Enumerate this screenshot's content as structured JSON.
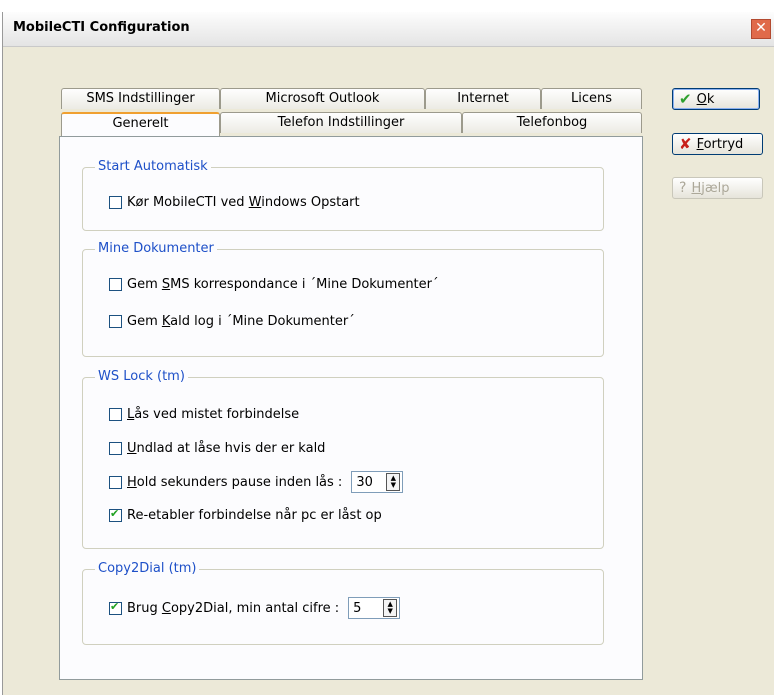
{
  "window": {
    "title": "MobileCTI Configuration",
    "close_glyph": "✕"
  },
  "tabs_row1": [
    "SMS Indstillinger",
    "Microsoft Outlook",
    "Internet",
    "Licens"
  ],
  "tabs_row2": [
    "Generelt",
    "Telefon Indstillinger",
    "Telefonbog"
  ],
  "active_tab": "Generelt",
  "groups": {
    "start": {
      "title": "Start Automatisk",
      "items": [
        {
          "pre": "Kør MobileCTI ved ",
          "u": "W",
          "post": "indows Opstart",
          "checked": false
        }
      ]
    },
    "docs": {
      "title": "Mine Dokumenter",
      "items": [
        {
          "pre": "Gem ",
          "u": "S",
          "post": "MS korrespondance i ´Mine Dokumenter´",
          "checked": false
        },
        {
          "pre": "Gem ",
          "u": "K",
          "post": "ald log i ´Mine Dokumenter´",
          "checked": false
        }
      ]
    },
    "wslock": {
      "title": "WS Lock (tm)",
      "items": [
        {
          "pre": "",
          "u": "L",
          "post": "ås ved mistet forbindelse",
          "checked": false
        },
        {
          "pre": "",
          "u": "U",
          "post": "ndlad at låse hvis der er kald",
          "checked": false
        },
        {
          "pre": "",
          "u": "H",
          "post": "old sekunders pause inden lås :",
          "checked": false
        },
        {
          "pre": "",
          "u": "",
          "post": "Re-etabler forbindelse når pc er låst op",
          "checked": true
        }
      ],
      "pause_value": "30"
    },
    "copy2dial": {
      "title": "Copy2Dial (tm)",
      "items": [
        {
          "pre": "Brug ",
          "u": "C",
          "post": "opy2Dial, min antal cifre :",
          "checked": true
        }
      ],
      "digits_value": "5"
    }
  },
  "buttons": {
    "ok": {
      "icon": "✔",
      "u": "O",
      "post": "k"
    },
    "cancel": {
      "icon": "✘",
      "u": "F",
      "post": "ortryd"
    },
    "help": {
      "icon": "?",
      "u": "H",
      "post": "jælp"
    }
  },
  "spin_glyphs": {
    "up": "▲",
    "down": "▼"
  }
}
